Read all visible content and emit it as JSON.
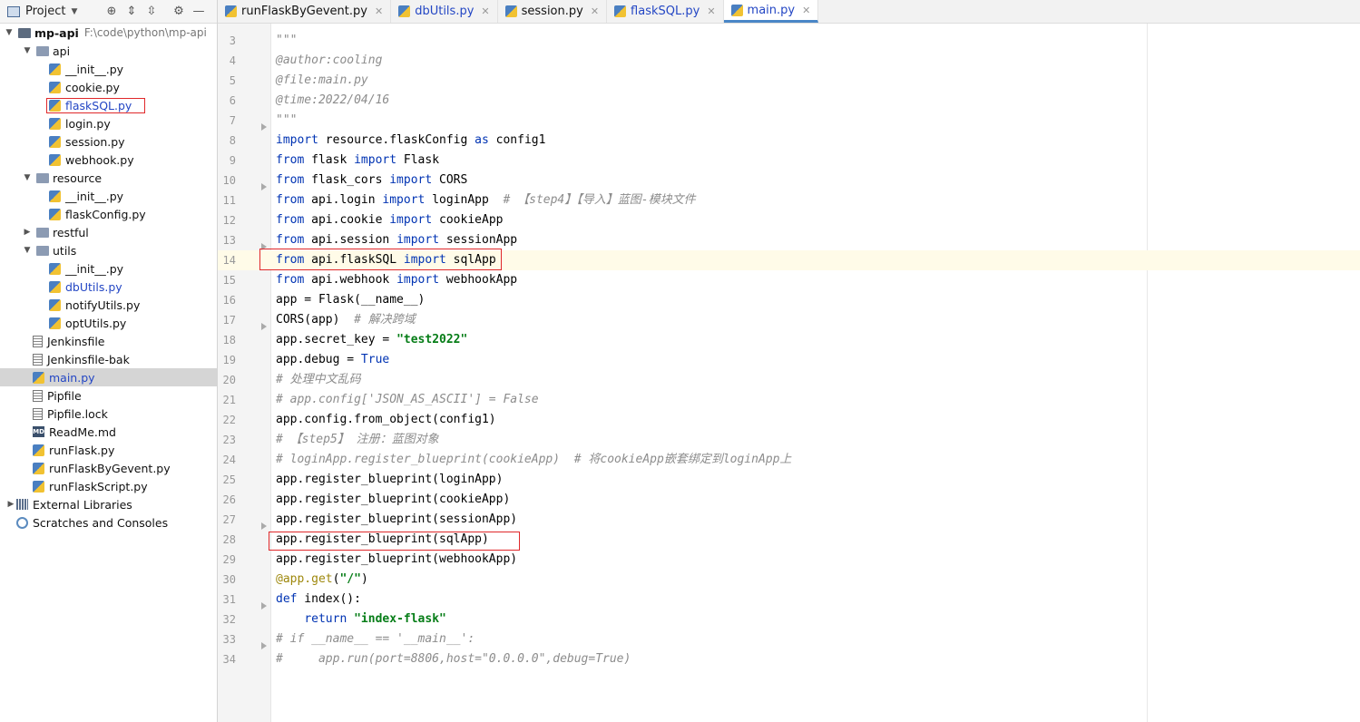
{
  "sidebar": {
    "project_label": "Project",
    "root": {
      "name": "mp-api",
      "path": "F:\\code\\python\\mp-api"
    },
    "items": [
      {
        "label": "api",
        "type": "folder",
        "indent": 1,
        "expanded": true
      },
      {
        "label": "__init__.py",
        "type": "py",
        "indent": 2
      },
      {
        "label": "cookie.py",
        "type": "py",
        "indent": 2
      },
      {
        "label": "flaskSQL.py",
        "type": "py",
        "indent": 2,
        "modified": true
      },
      {
        "label": "login.py",
        "type": "py",
        "indent": 2
      },
      {
        "label": "session.py",
        "type": "py",
        "indent": 2
      },
      {
        "label": "webhook.py",
        "type": "py",
        "indent": 2
      },
      {
        "label": "resource",
        "type": "folder",
        "indent": 1,
        "expanded": true
      },
      {
        "label": "__init__.py",
        "type": "py",
        "indent": 2
      },
      {
        "label": "flaskConfig.py",
        "type": "py",
        "indent": 2
      },
      {
        "label": "restful",
        "type": "folder",
        "indent": 1,
        "expanded": false
      },
      {
        "label": "utils",
        "type": "folder",
        "indent": 1,
        "expanded": true
      },
      {
        "label": "__init__.py",
        "type": "py",
        "indent": 2
      },
      {
        "label": "dbUtils.py",
        "type": "py",
        "indent": 2,
        "modified": true
      },
      {
        "label": "notifyUtils.py",
        "type": "py",
        "indent": 2
      },
      {
        "label": "optUtils.py",
        "type": "py",
        "indent": 2
      },
      {
        "label": "Jenkinsfile",
        "type": "txt",
        "indent": 1
      },
      {
        "label": "Jenkinsfile-bak",
        "type": "txt",
        "indent": 1
      },
      {
        "label": "main.py",
        "type": "py",
        "indent": 1,
        "modified": true,
        "selected": true
      },
      {
        "label": "Pipfile",
        "type": "txt",
        "indent": 1
      },
      {
        "label": "Pipfile.lock",
        "type": "txt",
        "indent": 1
      },
      {
        "label": "ReadMe.md",
        "type": "md",
        "indent": 1
      },
      {
        "label": "runFlask.py",
        "type": "py",
        "indent": 1
      },
      {
        "label": "runFlaskByGevent.py",
        "type": "py",
        "indent": 1
      },
      {
        "label": "runFlaskScript.py",
        "type": "py",
        "indent": 1
      },
      {
        "label": "External Libraries",
        "type": "lib",
        "indent": 0,
        "expanded": false
      },
      {
        "label": "Scratches and Consoles",
        "type": "scratch",
        "indent": 0
      }
    ]
  },
  "tabs": [
    {
      "label": "runFlaskByGevent.py",
      "modified": false
    },
    {
      "label": "dbUtils.py",
      "modified": true
    },
    {
      "label": "session.py",
      "modified": false
    },
    {
      "label": "flaskSQL.py",
      "modified": true
    },
    {
      "label": "main.py",
      "modified": true,
      "active": true
    }
  ],
  "editor": {
    "current_line": 14,
    "lines": [
      {
        "n": "3",
        "tokens": [
          [
            "cm",
            "\"\"\""
          ]
        ]
      },
      {
        "n": "4",
        "tokens": [
          [
            "cm",
            "@author:cooling"
          ]
        ]
      },
      {
        "n": "5",
        "tokens": [
          [
            "cm",
            "@file:main.py"
          ]
        ]
      },
      {
        "n": "6",
        "tokens": [
          [
            "cm",
            "@time:2022/04/16"
          ]
        ]
      },
      {
        "n": "7",
        "tokens": [
          [
            "cm",
            "\"\"\""
          ]
        ]
      },
      {
        "n": "8",
        "tokens": [
          [
            "kw",
            "import"
          ],
          [
            "",
            " resource.flaskConfig "
          ],
          [
            "kw",
            "as"
          ],
          [
            "",
            " config1"
          ]
        ]
      },
      {
        "n": "9",
        "tokens": [
          [
            "kw",
            "from"
          ],
          [
            "",
            " flask "
          ],
          [
            "kw",
            "import"
          ],
          [
            "",
            " Flask"
          ]
        ]
      },
      {
        "n": "10",
        "tokens": [
          [
            "kw",
            "from"
          ],
          [
            "",
            " flask_cors "
          ],
          [
            "kw",
            "import"
          ],
          [
            "",
            " CORS"
          ]
        ]
      },
      {
        "n": "11",
        "tokens": [
          [
            "kw",
            "from"
          ],
          [
            "",
            " api.login "
          ],
          [
            "kw",
            "import"
          ],
          [
            "",
            " loginApp  "
          ],
          [
            "cm",
            "# 【step4】【导入】蓝图-模块文件"
          ]
        ]
      },
      {
        "n": "12",
        "tokens": [
          [
            "kw",
            "from"
          ],
          [
            "",
            " api.cookie "
          ],
          [
            "kw",
            "import"
          ],
          [
            "",
            " cookieApp"
          ]
        ]
      },
      {
        "n": "13",
        "tokens": [
          [
            "kw",
            "from"
          ],
          [
            "",
            " api.session "
          ],
          [
            "kw",
            "import"
          ],
          [
            "",
            " sessionApp"
          ]
        ]
      },
      {
        "n": "14",
        "tokens": [
          [
            "kw",
            "from"
          ],
          [
            "",
            " api.flaskSQL "
          ],
          [
            "kw",
            "import"
          ],
          [
            "",
            " sqlApp"
          ]
        ]
      },
      {
        "n": "15",
        "tokens": [
          [
            "kw",
            "from"
          ],
          [
            "",
            " api.webhook "
          ],
          [
            "kw",
            "import"
          ],
          [
            "",
            " webhookApp"
          ]
        ]
      },
      {
        "n": "16",
        "tokens": [
          [
            "",
            "app = Flask(__name__)"
          ]
        ]
      },
      {
        "n": "17",
        "tokens": [
          [
            "",
            "CORS(app)  "
          ],
          [
            "cm",
            "# 解决跨域"
          ]
        ]
      },
      {
        "n": "18",
        "tokens": [
          [
            "",
            "app.secret_key = "
          ],
          [
            "st",
            "\"test2022\""
          ]
        ]
      },
      {
        "n": "19",
        "tokens": [
          [
            "",
            "app.debug = "
          ],
          [
            "tr",
            "True"
          ]
        ]
      },
      {
        "n": "20",
        "tokens": [
          [
            "cm",
            "# 处理中文乱码"
          ]
        ]
      },
      {
        "n": "21",
        "tokens": [
          [
            "cm",
            "# app.config['JSON_AS_ASCII'] = False"
          ]
        ]
      },
      {
        "n": "22",
        "tokens": [
          [
            "",
            "app.config.from_object(config1)"
          ]
        ]
      },
      {
        "n": "23",
        "tokens": [
          [
            "cm",
            "# 【step5】 注册：蓝图对象"
          ]
        ]
      },
      {
        "n": "24",
        "tokens": [
          [
            "cm",
            "# loginApp.register_blueprint(cookieApp)  # 将cookieApp嵌套绑定到loginApp上"
          ]
        ]
      },
      {
        "n": "25",
        "tokens": [
          [
            "",
            "app.register_blueprint(loginApp)"
          ]
        ]
      },
      {
        "n": "26",
        "tokens": [
          [
            "",
            "app.register_blueprint(cookieApp)"
          ]
        ]
      },
      {
        "n": "27",
        "tokens": [
          [
            "",
            "app.register_blueprint(sessionApp)"
          ]
        ]
      },
      {
        "n": "28",
        "tokens": [
          [
            "",
            "app.register_blueprint(sqlApp)"
          ]
        ]
      },
      {
        "n": "29",
        "tokens": [
          [
            "",
            "app.register_blueprint(webhookApp)"
          ]
        ]
      },
      {
        "n": "30",
        "tokens": [
          [
            "dec",
            "@app.get"
          ],
          [
            "",
            "("
          ],
          [
            "st",
            "\"/\""
          ],
          [
            "",
            ")"
          ]
        ]
      },
      {
        "n": "31",
        "tokens": [
          [
            "kw",
            "def"
          ],
          [
            "",
            " index():"
          ]
        ]
      },
      {
        "n": "32",
        "tokens": [
          [
            "",
            "    "
          ],
          [
            "kw",
            "return"
          ],
          [
            "",
            " "
          ],
          [
            "st",
            "\"index-flask\""
          ]
        ]
      },
      {
        "n": "33",
        "tokens": [
          [
            "cm",
            "# if __name__ == '__main__':"
          ]
        ]
      },
      {
        "n": "34",
        "tokens": [
          [
            "cm",
            "#     app.run(port=8806,host=\"0.0.0.0\",debug=True)"
          ]
        ]
      }
    ]
  }
}
